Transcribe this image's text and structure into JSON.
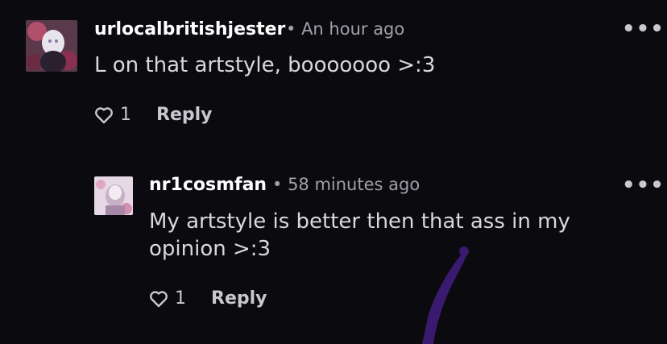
{
  "comments": [
    {
      "username": "urlocalbritishjester",
      "timestamp": "An hour ago",
      "body": "L on that artstyle, booooooo >:3",
      "likes": "1",
      "reply_label": "Reply",
      "more_label": "•••"
    },
    {
      "username": "nr1cosmfan",
      "timestamp": "58 minutes ago",
      "body": "My artstyle is better then that ass in my opinion >:3",
      "likes": "1",
      "reply_label": "Reply",
      "more_label": "•••"
    }
  ],
  "colors": {
    "background": "#0a0a0f",
    "username": "#ffffff",
    "meta": "#a0a0a8",
    "body": "#d8d8de",
    "accent": "#3a1a6e"
  },
  "icons": {
    "like": "heart-icon",
    "more": "more-options-icon"
  }
}
